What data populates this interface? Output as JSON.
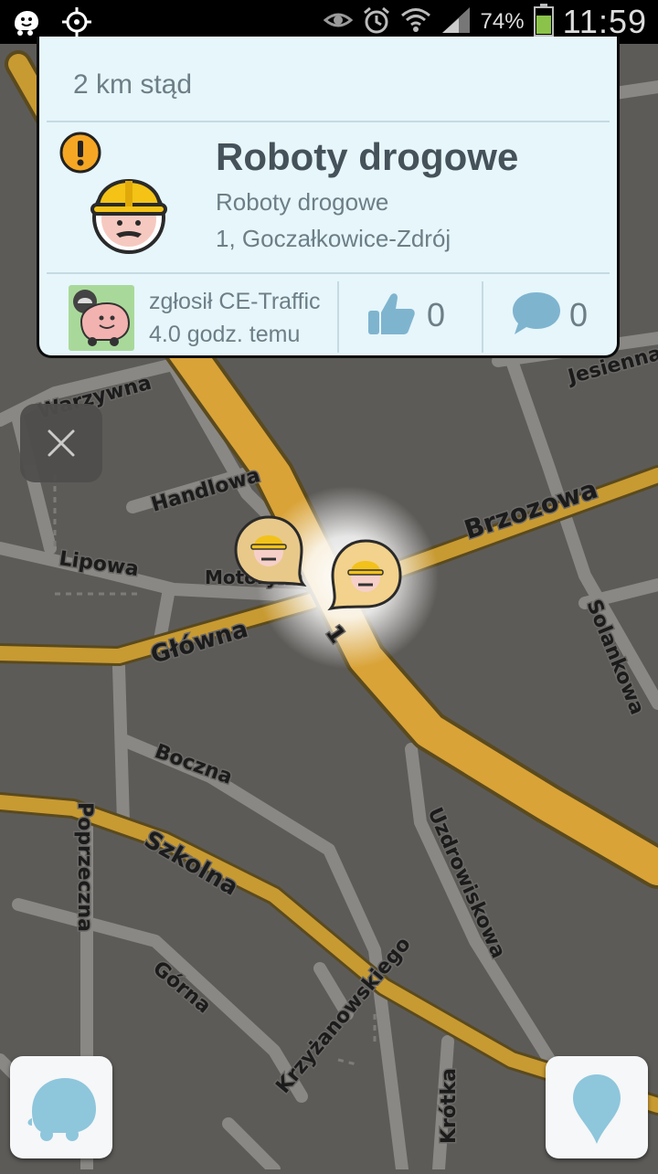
{
  "status_bar": {
    "battery_percent": "74%",
    "battery_level": 0.74,
    "time": "11:59",
    "icons": [
      "waze-icon",
      "gps-icon",
      "eye-icon",
      "alarm-icon",
      "wifi-icon",
      "signal-icon",
      "battery-icon"
    ]
  },
  "report_card": {
    "distance": "2 km stąd",
    "title": "Roboty drogowe",
    "subtitle": "Roboty drogowe",
    "address": "1, Goczałkowice-Zdrój",
    "reporter_line1": "zgłosił CE-Traffic",
    "reporter_line2": "4.0 godz. temu",
    "thumbs_count": "0",
    "comments_count": "0"
  },
  "map": {
    "streets": [
      "Warzywna",
      "Jesienna",
      "Handlowa",
      "Brzozowa",
      "Lipowa",
      "Motoryka",
      "Główna",
      "1",
      "Solankowa",
      "Boczna",
      "Poprzeczna",
      "Szkolna",
      "Uzdrowiskowa",
      "Krzyżanowskiego",
      "Górna",
      "Krótka"
    ],
    "road_color": "#d9a338",
    "minor_road_color": "#8a8885",
    "background_color": "#5d5b58"
  }
}
